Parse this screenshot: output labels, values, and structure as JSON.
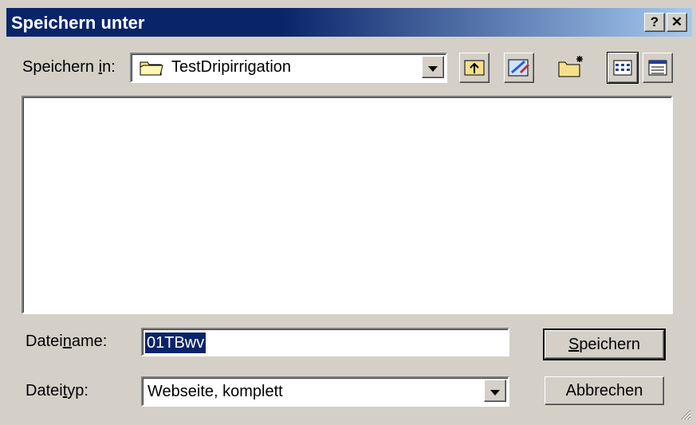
{
  "window": {
    "title": "Speichern unter",
    "help_label": "?",
    "close_label": "✕"
  },
  "save_in": {
    "label_pre": "Speichern ",
    "label_ul": "i",
    "label_post": "n:",
    "value": "TestDripirrigation"
  },
  "toolbar_icons": [
    "folder-up-icon",
    "desktop-icon",
    "new-folder-icon",
    "list-view-icon",
    "details-view-icon"
  ],
  "filename": {
    "label_pre": "Datei",
    "label_ul": "n",
    "label_post": "ame:",
    "value": "01TBwv"
  },
  "filetype": {
    "label_pre": "Datei",
    "label_ul": "t",
    "label_post": "yp:",
    "value": "Webseite, komplett"
  },
  "buttons": {
    "save_ul": "S",
    "save_rest": "peichern",
    "cancel": "Abbrechen"
  }
}
